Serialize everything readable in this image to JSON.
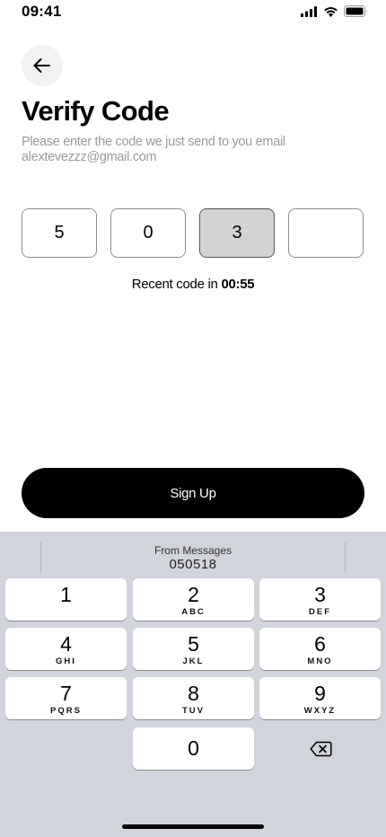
{
  "status_bar": {
    "time": "09:41"
  },
  "header": {
    "title": "Verify Code",
    "subtitle_line1": "Please enter the code we just send to you email",
    "subtitle_email": "alextevezzz@gmail.com"
  },
  "code_inputs": [
    {
      "value": "5"
    },
    {
      "value": "0"
    },
    {
      "value": "3"
    },
    {
      "value": ""
    }
  ],
  "resend": {
    "label": "Recent code in",
    "timer": "00:55"
  },
  "signup_button": {
    "label": "Sign Up"
  },
  "keyboard": {
    "suggestion_label": "From Messages",
    "suggestion_code": "050518",
    "keys": [
      {
        "digit": "1",
        "letters": ""
      },
      {
        "digit": "2",
        "letters": "ABC"
      },
      {
        "digit": "3",
        "letters": "DEF"
      },
      {
        "digit": "4",
        "letters": "GHI"
      },
      {
        "digit": "5",
        "letters": "JKL"
      },
      {
        "digit": "6",
        "letters": "MNO"
      },
      {
        "digit": "7",
        "letters": "PQRS"
      },
      {
        "digit": "8",
        "letters": "TUV"
      },
      {
        "digit": "9",
        "letters": "WXYZ"
      },
      {
        "digit": "0",
        "letters": ""
      }
    ]
  },
  "icons": {
    "back": "arrow-left-icon",
    "signal": "cellular-signal-icon",
    "wifi": "wifi-icon",
    "battery": "battery-icon",
    "delete": "backspace-icon"
  },
  "colors": {
    "primary_button": "#000000",
    "active_code_box": "#d3d3d3",
    "keyboard_bg": "#d1d4db",
    "subtitle_text": "#9a9a9a"
  }
}
